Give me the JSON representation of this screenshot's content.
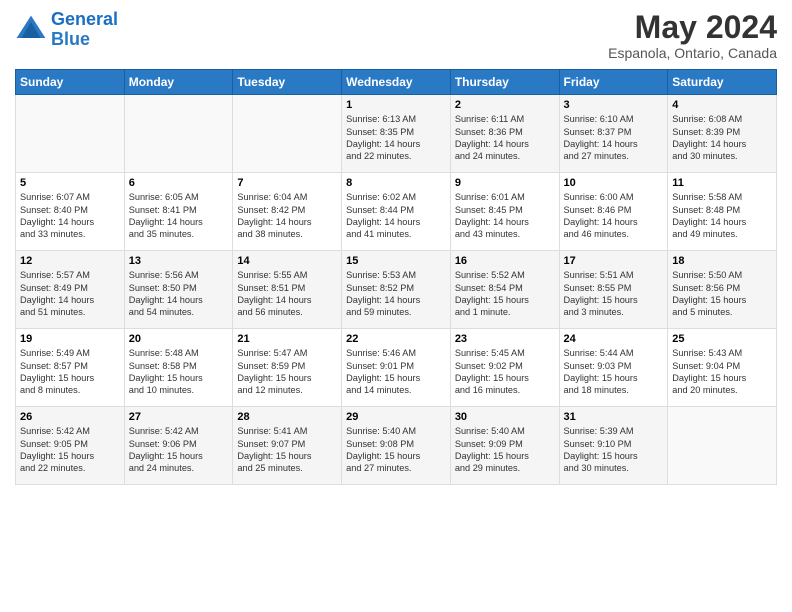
{
  "header": {
    "logo_line1": "General",
    "logo_line2": "Blue",
    "title": "May 2024",
    "subtitle": "Espanola, Ontario, Canada"
  },
  "weekdays": [
    "Sunday",
    "Monday",
    "Tuesday",
    "Wednesday",
    "Thursday",
    "Friday",
    "Saturday"
  ],
  "weeks": [
    [
      {
        "day": "",
        "info": ""
      },
      {
        "day": "",
        "info": ""
      },
      {
        "day": "",
        "info": ""
      },
      {
        "day": "1",
        "info": "Sunrise: 6:13 AM\nSunset: 8:35 PM\nDaylight: 14 hours\nand 22 minutes."
      },
      {
        "day": "2",
        "info": "Sunrise: 6:11 AM\nSunset: 8:36 PM\nDaylight: 14 hours\nand 24 minutes."
      },
      {
        "day": "3",
        "info": "Sunrise: 6:10 AM\nSunset: 8:37 PM\nDaylight: 14 hours\nand 27 minutes."
      },
      {
        "day": "4",
        "info": "Sunrise: 6:08 AM\nSunset: 8:39 PM\nDaylight: 14 hours\nand 30 minutes."
      }
    ],
    [
      {
        "day": "5",
        "info": "Sunrise: 6:07 AM\nSunset: 8:40 PM\nDaylight: 14 hours\nand 33 minutes."
      },
      {
        "day": "6",
        "info": "Sunrise: 6:05 AM\nSunset: 8:41 PM\nDaylight: 14 hours\nand 35 minutes."
      },
      {
        "day": "7",
        "info": "Sunrise: 6:04 AM\nSunset: 8:42 PM\nDaylight: 14 hours\nand 38 minutes."
      },
      {
        "day": "8",
        "info": "Sunrise: 6:02 AM\nSunset: 8:44 PM\nDaylight: 14 hours\nand 41 minutes."
      },
      {
        "day": "9",
        "info": "Sunrise: 6:01 AM\nSunset: 8:45 PM\nDaylight: 14 hours\nand 43 minutes."
      },
      {
        "day": "10",
        "info": "Sunrise: 6:00 AM\nSunset: 8:46 PM\nDaylight: 14 hours\nand 46 minutes."
      },
      {
        "day": "11",
        "info": "Sunrise: 5:58 AM\nSunset: 8:48 PM\nDaylight: 14 hours\nand 49 minutes."
      }
    ],
    [
      {
        "day": "12",
        "info": "Sunrise: 5:57 AM\nSunset: 8:49 PM\nDaylight: 14 hours\nand 51 minutes."
      },
      {
        "day": "13",
        "info": "Sunrise: 5:56 AM\nSunset: 8:50 PM\nDaylight: 14 hours\nand 54 minutes."
      },
      {
        "day": "14",
        "info": "Sunrise: 5:55 AM\nSunset: 8:51 PM\nDaylight: 14 hours\nand 56 minutes."
      },
      {
        "day": "15",
        "info": "Sunrise: 5:53 AM\nSunset: 8:52 PM\nDaylight: 14 hours\nand 59 minutes."
      },
      {
        "day": "16",
        "info": "Sunrise: 5:52 AM\nSunset: 8:54 PM\nDaylight: 15 hours\nand 1 minute."
      },
      {
        "day": "17",
        "info": "Sunrise: 5:51 AM\nSunset: 8:55 PM\nDaylight: 15 hours\nand 3 minutes."
      },
      {
        "day": "18",
        "info": "Sunrise: 5:50 AM\nSunset: 8:56 PM\nDaylight: 15 hours\nand 5 minutes."
      }
    ],
    [
      {
        "day": "19",
        "info": "Sunrise: 5:49 AM\nSunset: 8:57 PM\nDaylight: 15 hours\nand 8 minutes."
      },
      {
        "day": "20",
        "info": "Sunrise: 5:48 AM\nSunset: 8:58 PM\nDaylight: 15 hours\nand 10 minutes."
      },
      {
        "day": "21",
        "info": "Sunrise: 5:47 AM\nSunset: 8:59 PM\nDaylight: 15 hours\nand 12 minutes."
      },
      {
        "day": "22",
        "info": "Sunrise: 5:46 AM\nSunset: 9:01 PM\nDaylight: 15 hours\nand 14 minutes."
      },
      {
        "day": "23",
        "info": "Sunrise: 5:45 AM\nSunset: 9:02 PM\nDaylight: 15 hours\nand 16 minutes."
      },
      {
        "day": "24",
        "info": "Sunrise: 5:44 AM\nSunset: 9:03 PM\nDaylight: 15 hours\nand 18 minutes."
      },
      {
        "day": "25",
        "info": "Sunrise: 5:43 AM\nSunset: 9:04 PM\nDaylight: 15 hours\nand 20 minutes."
      }
    ],
    [
      {
        "day": "26",
        "info": "Sunrise: 5:42 AM\nSunset: 9:05 PM\nDaylight: 15 hours\nand 22 minutes."
      },
      {
        "day": "27",
        "info": "Sunrise: 5:42 AM\nSunset: 9:06 PM\nDaylight: 15 hours\nand 24 minutes."
      },
      {
        "day": "28",
        "info": "Sunrise: 5:41 AM\nSunset: 9:07 PM\nDaylight: 15 hours\nand 25 minutes."
      },
      {
        "day": "29",
        "info": "Sunrise: 5:40 AM\nSunset: 9:08 PM\nDaylight: 15 hours\nand 27 minutes."
      },
      {
        "day": "30",
        "info": "Sunrise: 5:40 AM\nSunset: 9:09 PM\nDaylight: 15 hours\nand 29 minutes."
      },
      {
        "day": "31",
        "info": "Sunrise: 5:39 AM\nSunset: 9:10 PM\nDaylight: 15 hours\nand 30 minutes."
      },
      {
        "day": "",
        "info": ""
      }
    ]
  ]
}
